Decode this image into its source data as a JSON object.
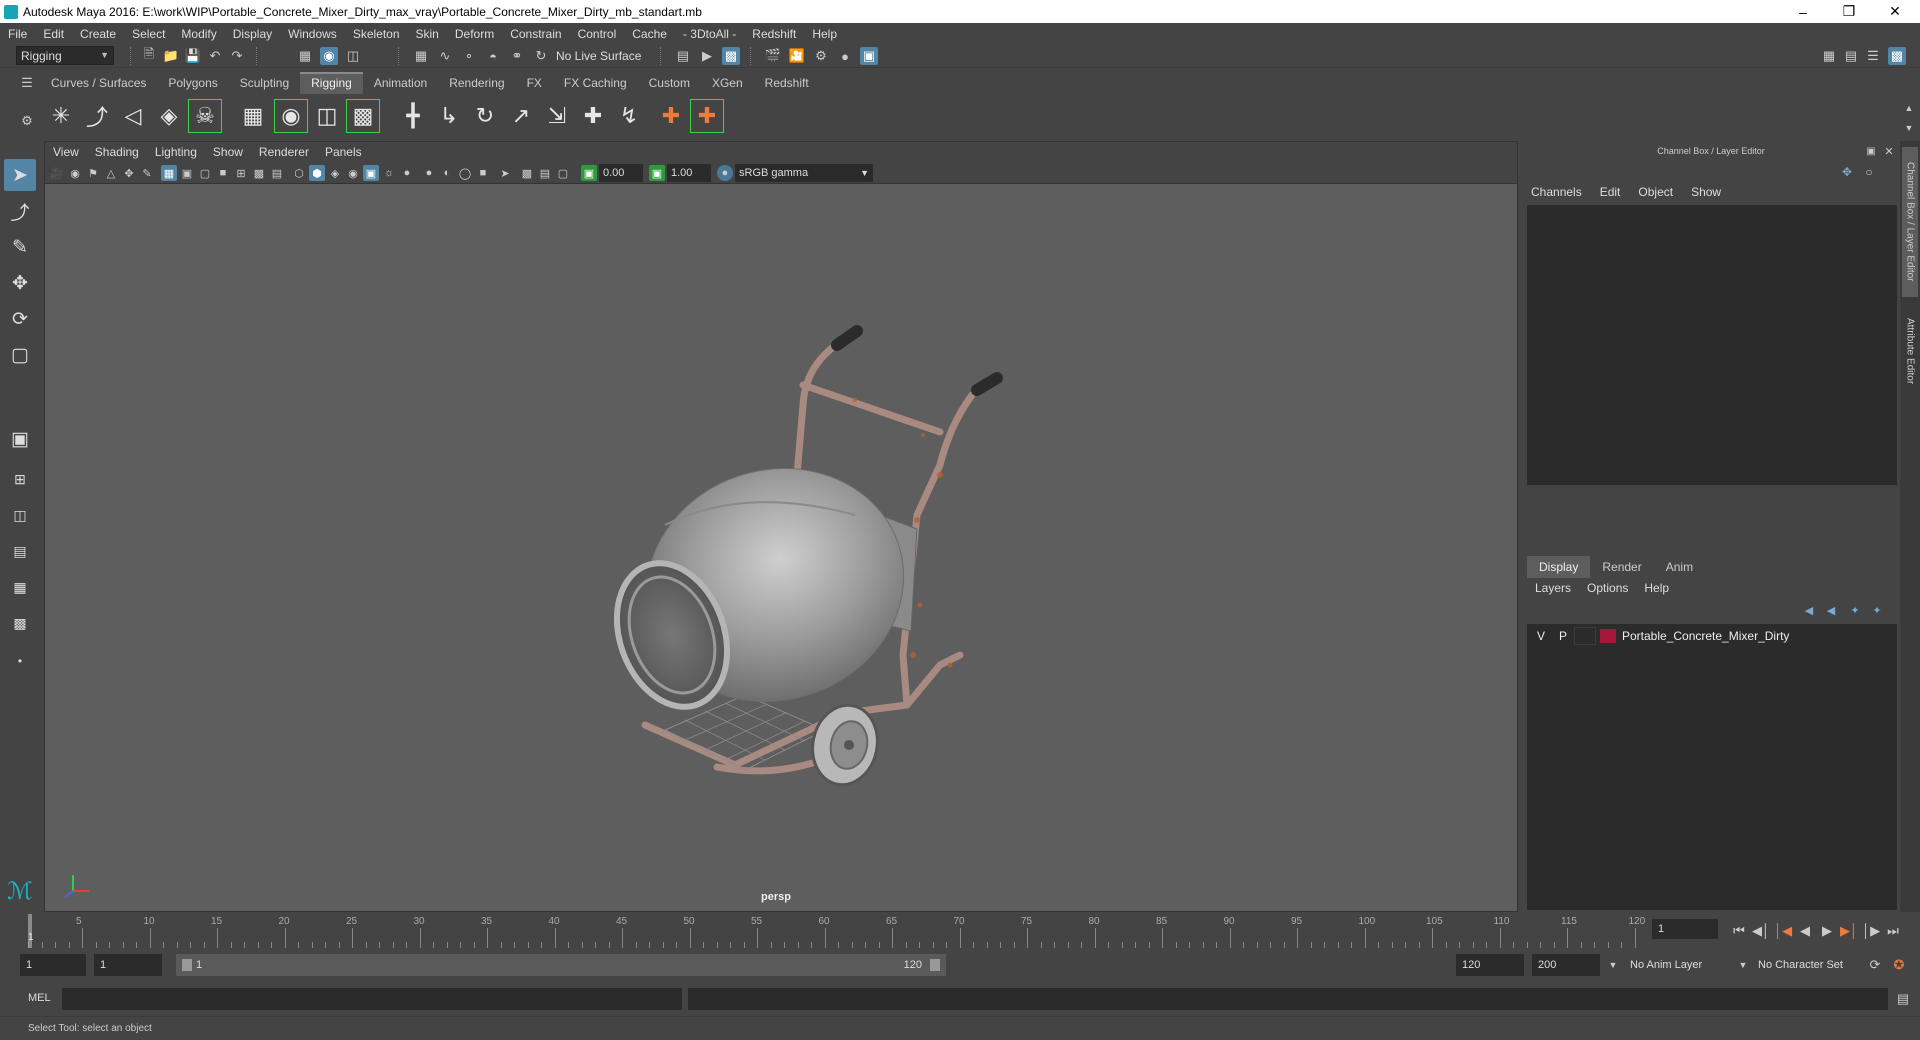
{
  "window": {
    "title": "Autodesk Maya 2016: E:\\work\\WIP\\Portable_Concrete_Mixer_Dirty_max_vray\\Portable_Concrete_Mixer_Dirty_mb_standart.mb"
  },
  "menubar": [
    "File",
    "Edit",
    "Create",
    "Select",
    "Modify",
    "Display",
    "Windows",
    "Skeleton",
    "Skin",
    "Deform",
    "Constrain",
    "Control",
    "Cache",
    "- 3DtoAll -",
    "Redshift",
    "Help"
  ],
  "status_line": {
    "mode": "Rigging",
    "live_surface": "No Live Surface"
  },
  "shelf": {
    "tabs": [
      "Curves / Surfaces",
      "Polygons",
      "Sculpting",
      "Rigging",
      "Animation",
      "Rendering",
      "FX",
      "FX Caching",
      "Custom",
      "XGen",
      "Redshift"
    ],
    "active_tab": "Rigging"
  },
  "viewport": {
    "menu": [
      "View",
      "Shading",
      "Lighting",
      "Show",
      "Renderer",
      "Panels"
    ],
    "exposure": "0.00",
    "gamma": "1.00",
    "color_space": "sRGB gamma",
    "camera_label": "persp"
  },
  "channel_box": {
    "title": "Channel Box / Layer Editor",
    "menu": [
      "Channels",
      "Edit",
      "Object",
      "Show"
    ]
  },
  "layer_editor": {
    "tabs": [
      "Display",
      "Render",
      "Anim"
    ],
    "active_tab": "Display",
    "menu": [
      "Layers",
      "Options",
      "Help"
    ],
    "layers": [
      {
        "v": "V",
        "p": "P",
        "name": "Portable_Concrete_Mixer_Dirty",
        "color": "#a3173a"
      }
    ]
  },
  "side_tabs": [
    "Channel Box / Layer Editor",
    "Attribute Editor"
  ],
  "time_slider": {
    "ticks": [
      "5",
      "10",
      "15",
      "20",
      "25",
      "30",
      "35",
      "40",
      "45",
      "50",
      "55",
      "60",
      "65",
      "70",
      "75",
      "80",
      "85",
      "90",
      "95",
      "100",
      "105",
      "110",
      "115",
      "120"
    ],
    "start_label": "1",
    "current_frame": "1"
  },
  "range_slider": {
    "start": "1",
    "playback_start": "1",
    "range_start": "1",
    "range_end": "120",
    "playback_end": "120",
    "end": "200",
    "anim_layer": "No Anim Layer",
    "character_set": "No Character Set"
  },
  "command_line": {
    "label": "MEL"
  },
  "help_line": {
    "text": "Select Tool: select an object"
  }
}
